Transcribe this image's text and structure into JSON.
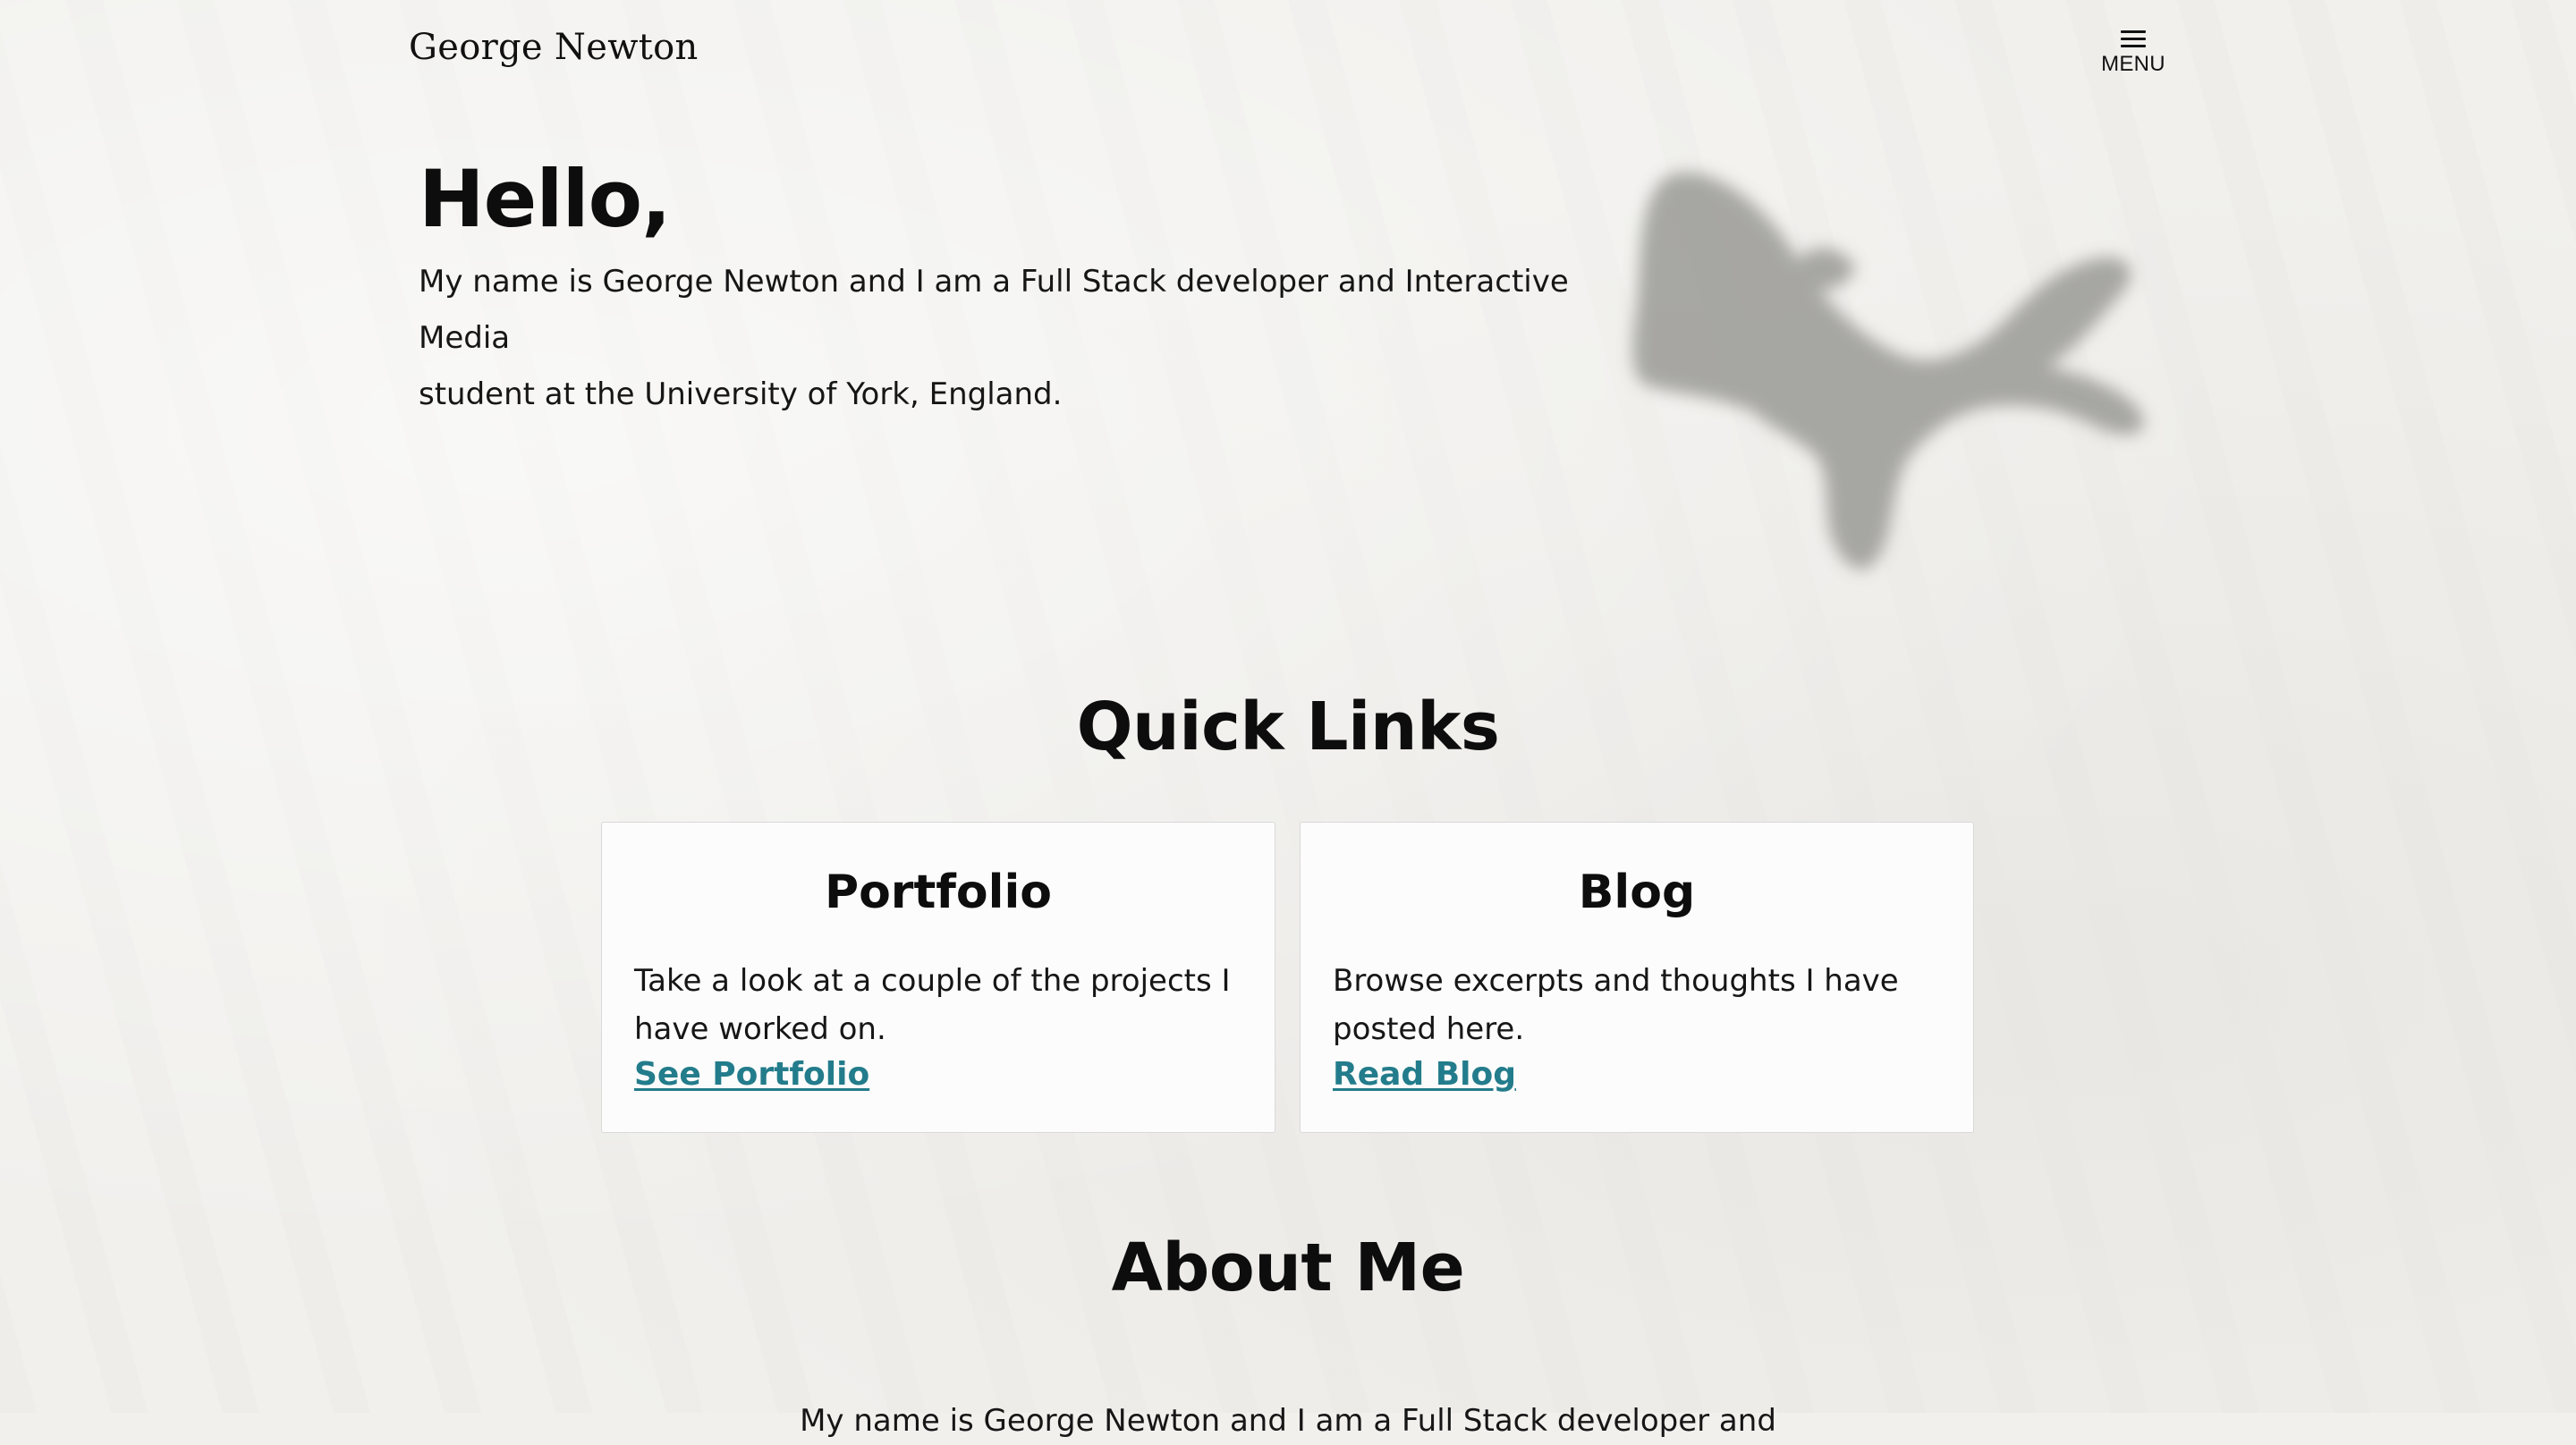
{
  "header": {
    "brand": "George Newton",
    "menu_label": "MENU",
    "menu_icon": "hamburger-icon"
  },
  "hero": {
    "heading": "Hello,",
    "intro_line1": "My name is George Newton and I am a Full Stack developer and Interactive Media",
    "intro_line2": "student at the University of York, England."
  },
  "decoration": {
    "fish_shadow": "fish-shadow-icon"
  },
  "quick_links": {
    "title": "Quick Links",
    "cards": [
      {
        "title": "Portfolio",
        "description": "Take a look at a couple of the projects I have worked on.",
        "link_label": "See Portfolio"
      },
      {
        "title": "Blog",
        "description": "Browse excerpts and thoughts I have posted here.",
        "link_label": "Read Blog"
      }
    ]
  },
  "about": {
    "title": "About Me",
    "text_visible": "My name is George Newton and I am a Full Stack developer and"
  },
  "colors": {
    "background": "#f1f0ed",
    "link": "#237c8b",
    "card_background": "#fbfcfb",
    "text": "#0d0d0d"
  }
}
